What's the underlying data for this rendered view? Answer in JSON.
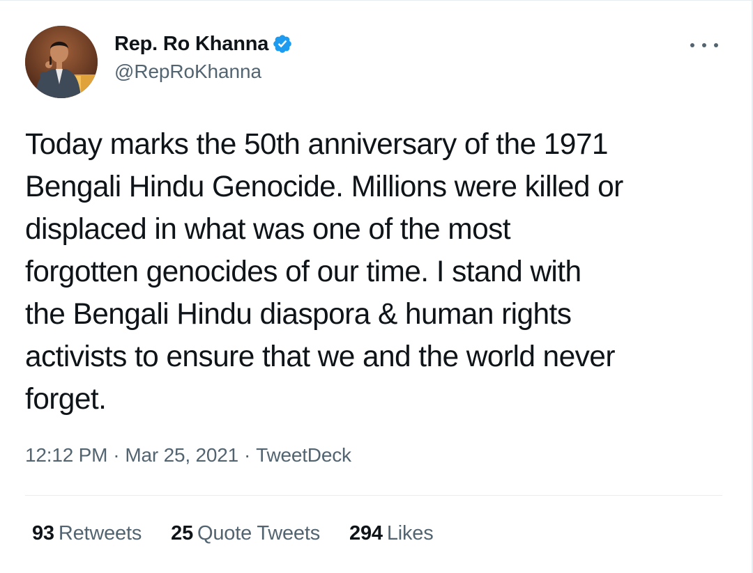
{
  "colors": {
    "text_primary": "#0f1419",
    "text_secondary": "#536471",
    "verified_blue": "#1d9bf0",
    "divider": "#e6ecf0"
  },
  "author": {
    "display_name": "Rep. Ro Khanna",
    "handle": "@RepRoKhanna",
    "verified": true,
    "avatar_icon": "profile-photo",
    "verified_icon": "verified-badge-icon"
  },
  "more_icon": "ellipsis-icon",
  "tweet": {
    "text": "Today marks the 50th anniversary of the 1971\nBengali Hindu Genocide. Millions were killed or\ndisplaced in what was one of the most\nforgotten genocides of our time. I stand with\nthe Bengali Hindu diaspora & human rights\nactivists to ensure that we and the world never\nforget."
  },
  "meta": {
    "time": "12:12 PM",
    "separator": "·",
    "date": "Mar 25, 2021",
    "source": "TweetDeck"
  },
  "stats": {
    "retweets": {
      "count": "93",
      "label": "Retweets"
    },
    "quote_tweets": {
      "count": "25",
      "label": "Quote Tweets"
    },
    "likes": {
      "count": "294",
      "label": "Likes"
    }
  }
}
